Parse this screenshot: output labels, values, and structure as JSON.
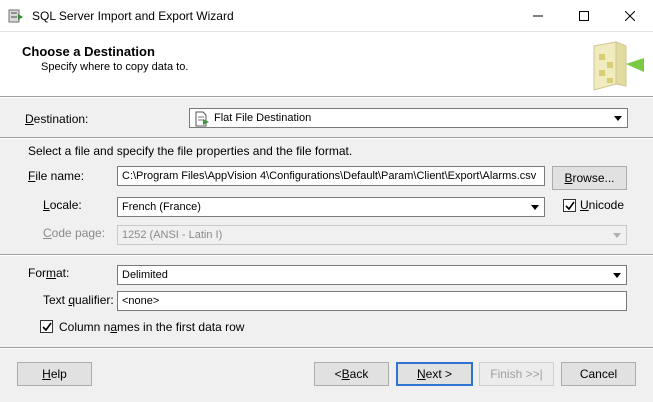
{
  "window": {
    "title": "SQL Server Import and Export Wizard",
    "controls": [
      "minimize-icon",
      "maximize-icon",
      "close-icon"
    ]
  },
  "header": {
    "title": "Choose a Destination",
    "subtitle": "Specify where to copy data to."
  },
  "destination": {
    "label": "Destination:",
    "value": "Flat File Destination"
  },
  "instructions": "Select a file and specify the file properties and the file format.",
  "file_name": {
    "label": "File name:",
    "value": "C:\\Program Files\\AppVision 4\\Configurations\\Default\\Param\\Client\\Export\\Alarms.csv",
    "browse_label": "Browse..."
  },
  "locale": {
    "label": "Locale:",
    "value": "French (France)"
  },
  "unicode": {
    "label": "Unicode",
    "checked": true
  },
  "code_page": {
    "label": "Code page:",
    "value": "1252  (ANSI - Latin I)",
    "enabled": false
  },
  "format": {
    "label": "Format:",
    "value": "Delimited"
  },
  "text_qualifier": {
    "label": "Text qualifier:",
    "value": "<none>"
  },
  "column_names": {
    "label": "Column names in the first data row",
    "checked": true
  },
  "buttons": {
    "help": "Help",
    "back": "< Back",
    "next": "Next >",
    "finish": "Finish >>|",
    "cancel": "Cancel"
  },
  "colors": {
    "default_button_border": "#2f74d0",
    "disabled_text": "#8a8a8a"
  }
}
